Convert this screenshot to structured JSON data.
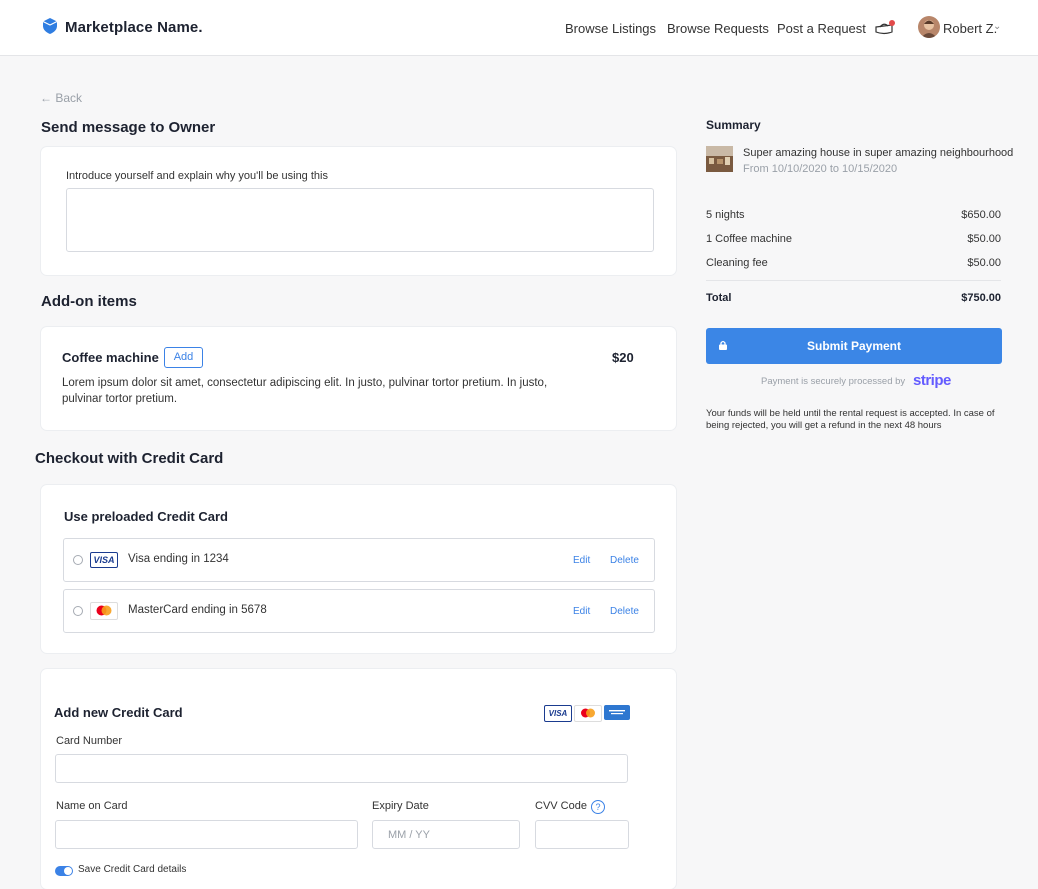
{
  "header": {
    "brand": "Marketplace Name.",
    "nav": [
      "Browse Listings",
      "Browse Requests",
      "Post a Request"
    ],
    "user_name": "Robert Z."
  },
  "back_label": "Back",
  "message": {
    "title": "Send message to Owner",
    "label": "Introduce yourself and explain why you'll be using this"
  },
  "addons": {
    "title": "Add-on items",
    "item_name": "Coffee machine",
    "add_label": "Add",
    "price": "$20",
    "description": "Lorem ipsum dolor sit amet, consectetur adipiscing elit. In justo, pulvinar tortor pretium. In justo, pulvinar tortor pretium."
  },
  "checkout": {
    "title": "Checkout with Credit Card",
    "preloaded_title": "Use preloaded Credit Card",
    "cards": [
      {
        "brand": "VISA",
        "label": "Visa ending in 1234"
      },
      {
        "brand": "MasterCard",
        "label": "MasterCard ending in 5678"
      }
    ],
    "edit_label": "Edit",
    "delete_label": "Delete"
  },
  "new_card": {
    "title": "Add new Credit Card",
    "card_number_label": "Card Number",
    "name_label": "Name on Card",
    "expiry_label": "Expiry Date",
    "expiry_placeholder": "MM / YY",
    "cvv_label": "CVV Code",
    "save_label": "Save Credit Card details",
    "visa_text": "VISA"
  },
  "summary": {
    "title": "Summary",
    "listing_title": "Super amazing house in super amazing neighbourhood",
    "listing_dates": "From 10/10/2020 to 10/15/2020",
    "items": [
      {
        "label": "5 nights",
        "value": "$650.00"
      },
      {
        "label": "1 Coffee machine",
        "value": "$50.00"
      },
      {
        "label": "Cleaning fee",
        "value": "$50.00"
      }
    ],
    "total_label": "Total",
    "total_value": "$750.00",
    "pay_label": "Submit Payment",
    "secure_text": "Payment is securely processed by",
    "stripe_text": "stripe",
    "note": "Your funds will be held until the rental request is accepted. In case of being rejected, you will get a refund in the next 48 hours"
  },
  "colors": {
    "accent": "#3b86e6",
    "stripe": "#635bff"
  }
}
